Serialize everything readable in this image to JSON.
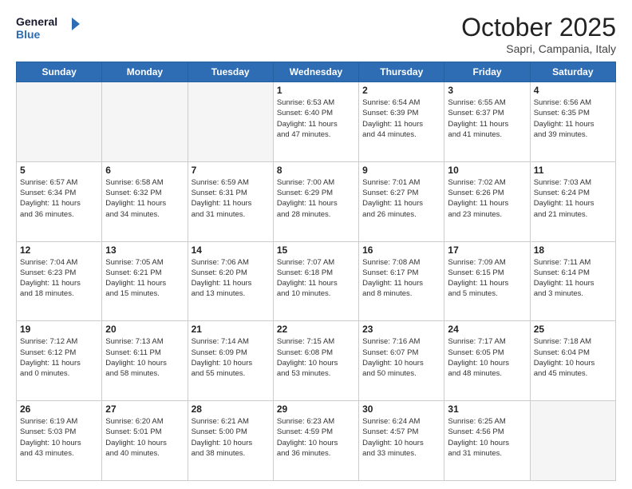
{
  "header": {
    "logo_line1": "General",
    "logo_line2": "Blue",
    "month": "October 2025",
    "location": "Sapri, Campania, Italy"
  },
  "days_of_week": [
    "Sunday",
    "Monday",
    "Tuesday",
    "Wednesday",
    "Thursday",
    "Friday",
    "Saturday"
  ],
  "weeks": [
    [
      {
        "day": "",
        "info": []
      },
      {
        "day": "",
        "info": []
      },
      {
        "day": "",
        "info": []
      },
      {
        "day": "1",
        "info": [
          "Sunrise: 6:53 AM",
          "Sunset: 6:40 PM",
          "Daylight: 11 hours",
          "and 47 minutes."
        ]
      },
      {
        "day": "2",
        "info": [
          "Sunrise: 6:54 AM",
          "Sunset: 6:39 PM",
          "Daylight: 11 hours",
          "and 44 minutes."
        ]
      },
      {
        "day": "3",
        "info": [
          "Sunrise: 6:55 AM",
          "Sunset: 6:37 PM",
          "Daylight: 11 hours",
          "and 41 minutes."
        ]
      },
      {
        "day": "4",
        "info": [
          "Sunrise: 6:56 AM",
          "Sunset: 6:35 PM",
          "Daylight: 11 hours",
          "and 39 minutes."
        ]
      }
    ],
    [
      {
        "day": "5",
        "info": [
          "Sunrise: 6:57 AM",
          "Sunset: 6:34 PM",
          "Daylight: 11 hours",
          "and 36 minutes."
        ]
      },
      {
        "day": "6",
        "info": [
          "Sunrise: 6:58 AM",
          "Sunset: 6:32 PM",
          "Daylight: 11 hours",
          "and 34 minutes."
        ]
      },
      {
        "day": "7",
        "info": [
          "Sunrise: 6:59 AM",
          "Sunset: 6:31 PM",
          "Daylight: 11 hours",
          "and 31 minutes."
        ]
      },
      {
        "day": "8",
        "info": [
          "Sunrise: 7:00 AM",
          "Sunset: 6:29 PM",
          "Daylight: 11 hours",
          "and 28 minutes."
        ]
      },
      {
        "day": "9",
        "info": [
          "Sunrise: 7:01 AM",
          "Sunset: 6:27 PM",
          "Daylight: 11 hours",
          "and 26 minutes."
        ]
      },
      {
        "day": "10",
        "info": [
          "Sunrise: 7:02 AM",
          "Sunset: 6:26 PM",
          "Daylight: 11 hours",
          "and 23 minutes."
        ]
      },
      {
        "day": "11",
        "info": [
          "Sunrise: 7:03 AM",
          "Sunset: 6:24 PM",
          "Daylight: 11 hours",
          "and 21 minutes."
        ]
      }
    ],
    [
      {
        "day": "12",
        "info": [
          "Sunrise: 7:04 AM",
          "Sunset: 6:23 PM",
          "Daylight: 11 hours",
          "and 18 minutes."
        ]
      },
      {
        "day": "13",
        "info": [
          "Sunrise: 7:05 AM",
          "Sunset: 6:21 PM",
          "Daylight: 11 hours",
          "and 15 minutes."
        ]
      },
      {
        "day": "14",
        "info": [
          "Sunrise: 7:06 AM",
          "Sunset: 6:20 PM",
          "Daylight: 11 hours",
          "and 13 minutes."
        ]
      },
      {
        "day": "15",
        "info": [
          "Sunrise: 7:07 AM",
          "Sunset: 6:18 PM",
          "Daylight: 11 hours",
          "and 10 minutes."
        ]
      },
      {
        "day": "16",
        "info": [
          "Sunrise: 7:08 AM",
          "Sunset: 6:17 PM",
          "Daylight: 11 hours",
          "and 8 minutes."
        ]
      },
      {
        "day": "17",
        "info": [
          "Sunrise: 7:09 AM",
          "Sunset: 6:15 PM",
          "Daylight: 11 hours",
          "and 5 minutes."
        ]
      },
      {
        "day": "18",
        "info": [
          "Sunrise: 7:11 AM",
          "Sunset: 6:14 PM",
          "Daylight: 11 hours",
          "and 3 minutes."
        ]
      }
    ],
    [
      {
        "day": "19",
        "info": [
          "Sunrise: 7:12 AM",
          "Sunset: 6:12 PM",
          "Daylight: 11 hours",
          "and 0 minutes."
        ]
      },
      {
        "day": "20",
        "info": [
          "Sunrise: 7:13 AM",
          "Sunset: 6:11 PM",
          "Daylight: 10 hours",
          "and 58 minutes."
        ]
      },
      {
        "day": "21",
        "info": [
          "Sunrise: 7:14 AM",
          "Sunset: 6:09 PM",
          "Daylight: 10 hours",
          "and 55 minutes."
        ]
      },
      {
        "day": "22",
        "info": [
          "Sunrise: 7:15 AM",
          "Sunset: 6:08 PM",
          "Daylight: 10 hours",
          "and 53 minutes."
        ]
      },
      {
        "day": "23",
        "info": [
          "Sunrise: 7:16 AM",
          "Sunset: 6:07 PM",
          "Daylight: 10 hours",
          "and 50 minutes."
        ]
      },
      {
        "day": "24",
        "info": [
          "Sunrise: 7:17 AM",
          "Sunset: 6:05 PM",
          "Daylight: 10 hours",
          "and 48 minutes."
        ]
      },
      {
        "day": "25",
        "info": [
          "Sunrise: 7:18 AM",
          "Sunset: 6:04 PM",
          "Daylight: 10 hours",
          "and 45 minutes."
        ]
      }
    ],
    [
      {
        "day": "26",
        "info": [
          "Sunrise: 6:19 AM",
          "Sunset: 5:03 PM",
          "Daylight: 10 hours",
          "and 43 minutes."
        ]
      },
      {
        "day": "27",
        "info": [
          "Sunrise: 6:20 AM",
          "Sunset: 5:01 PM",
          "Daylight: 10 hours",
          "and 40 minutes."
        ]
      },
      {
        "day": "28",
        "info": [
          "Sunrise: 6:21 AM",
          "Sunset: 5:00 PM",
          "Daylight: 10 hours",
          "and 38 minutes."
        ]
      },
      {
        "day": "29",
        "info": [
          "Sunrise: 6:23 AM",
          "Sunset: 4:59 PM",
          "Daylight: 10 hours",
          "and 36 minutes."
        ]
      },
      {
        "day": "30",
        "info": [
          "Sunrise: 6:24 AM",
          "Sunset: 4:57 PM",
          "Daylight: 10 hours",
          "and 33 minutes."
        ]
      },
      {
        "day": "31",
        "info": [
          "Sunrise: 6:25 AM",
          "Sunset: 4:56 PM",
          "Daylight: 10 hours",
          "and 31 minutes."
        ]
      },
      {
        "day": "",
        "info": []
      }
    ]
  ]
}
